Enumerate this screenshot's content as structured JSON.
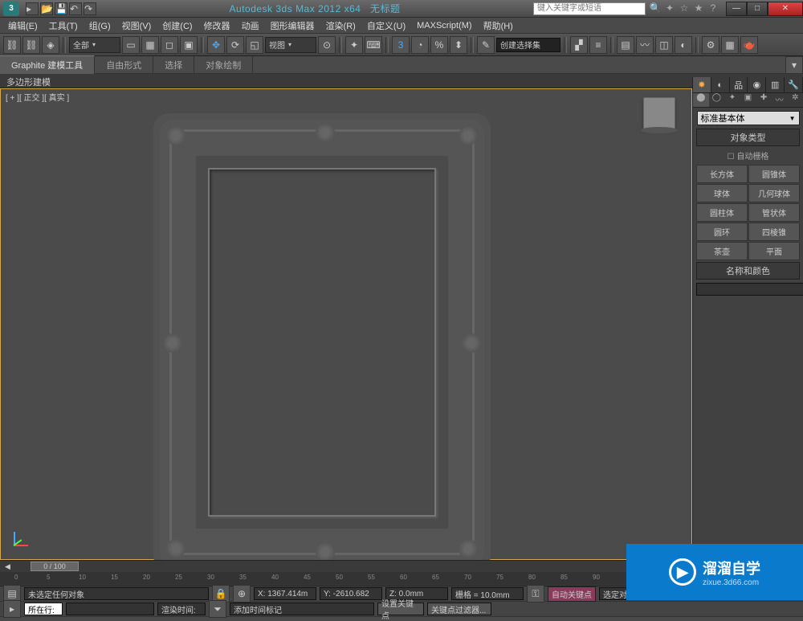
{
  "app": {
    "title": "Autodesk 3ds Max 2012 x64",
    "doc": "无标题",
    "search_placeholder": "键入关键字或短语"
  },
  "menu": [
    "编辑(E)",
    "工具(T)",
    "组(G)",
    "视图(V)",
    "创建(C)",
    "修改器",
    "动画",
    "图形编辑器",
    "渲染(R)",
    "自定义(U)",
    "MAXScript(M)",
    "帮助(H)"
  ],
  "toolbar": {
    "group_dropdown": "全部",
    "view_dropdown": "视图",
    "selset_dropdown": "创建选择集"
  },
  "ribbon": {
    "tabs": [
      "Graphite 建模工具",
      "自由形式",
      "选择",
      "对象绘制"
    ],
    "sub": "多边形建模"
  },
  "viewport": {
    "label": "[ + ][ 正交 ][ 真实 ]"
  },
  "panel": {
    "dropdown": "标准基本体",
    "section1": "对象类型",
    "autogrid": "自动栅格",
    "prims": [
      "长方体",
      "圆锥体",
      "球体",
      "几何球体",
      "圆柱体",
      "管状体",
      "圆环",
      "四棱锥",
      "茶壶",
      "平面"
    ],
    "section2": "名称和颜色"
  },
  "timeline": {
    "slider": "0 / 100",
    "ticks": [
      0,
      5,
      10,
      15,
      20,
      25,
      30,
      35,
      40,
      45,
      50,
      55,
      60,
      65,
      70,
      75,
      80,
      85,
      90
    ]
  },
  "status": {
    "sel": "未选定任何对象",
    "x": "X: 1367.414m",
    "y": "Y: -2610.682",
    "z": "Z: 0.0mm",
    "grid": "栅格 = 10.0mm",
    "autokey": "自动关键点",
    "selset": "选定对象",
    "row2_label": "所在行:",
    "render_time": "渲染时间:",
    "add_tag": "添加时间标记",
    "set_key": "设置关键点",
    "key_filter": "关键点过滤器..."
  },
  "watermark": {
    "brand": "溜溜自学",
    "url": "zixue.3d66.com"
  }
}
